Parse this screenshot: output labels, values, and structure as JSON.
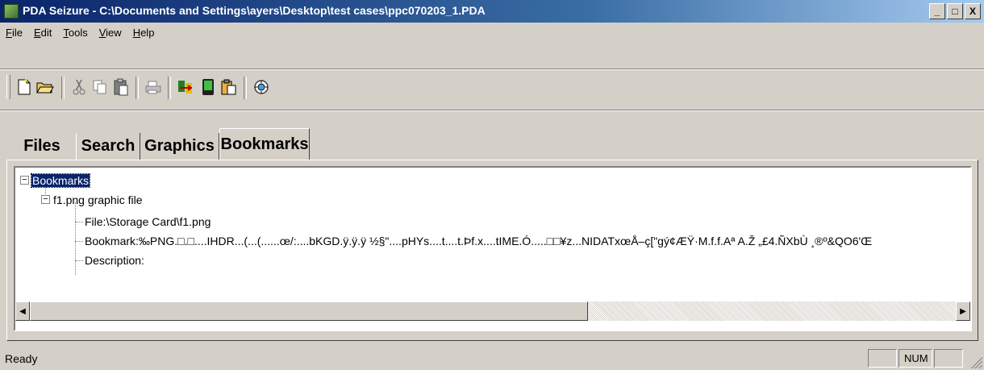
{
  "window": {
    "title": "PDA Seizure - C:\\Documents and Settings\\ayers\\Desktop\\test cases\\ppc070203_1.PDA",
    "buttons": {
      "minimize": "_",
      "maximize": "□",
      "close": "X"
    }
  },
  "menu": [
    {
      "underline": "F",
      "rest": "ile"
    },
    {
      "underline": "E",
      "rest": "dit"
    },
    {
      "underline": "T",
      "rest": "ools"
    },
    {
      "underline": "V",
      "rest": "iew"
    },
    {
      "underline": "H",
      "rest": "elp"
    }
  ],
  "toolbar": {
    "icons": [
      "new-document-icon",
      "open-folder-icon",
      "cut-icon",
      "copy-icon",
      "paste-icon",
      "print-icon",
      "acquire-icon",
      "pda-device-icon",
      "clipboard-icon",
      "about-icon"
    ]
  },
  "tabs": [
    {
      "label": "Files",
      "active": false
    },
    {
      "label": "Search",
      "active": false
    },
    {
      "label": "Graphics",
      "active": false
    },
    {
      "label": "Bookmarks",
      "active": true
    }
  ],
  "tree": {
    "root": {
      "label": "Bookmarks",
      "expander": "−"
    },
    "child": {
      "label": "f1.png graphic file",
      "expander": "−"
    },
    "details": [
      "File:\\Storage Card\\f1.png",
      "Bookmark:‰PNG.□.□....IHDR...(...(......œ/:....bKGD.ÿ.ÿ.ÿ ½§\"....pHYs....t....t.Þf.x....tIME.Ó.....□□¥z...NIDATxœÅ–ç[\"gý¢ÆŸ·M.f.f.Aª A.Ž „£4.ÑXbÙ ¸®º&QO6'Œ",
      "Description:"
    ]
  },
  "scrollbar": {
    "left_arrow": "◀",
    "right_arrow": "▶"
  },
  "status": {
    "text": "Ready",
    "num": "NUM"
  }
}
